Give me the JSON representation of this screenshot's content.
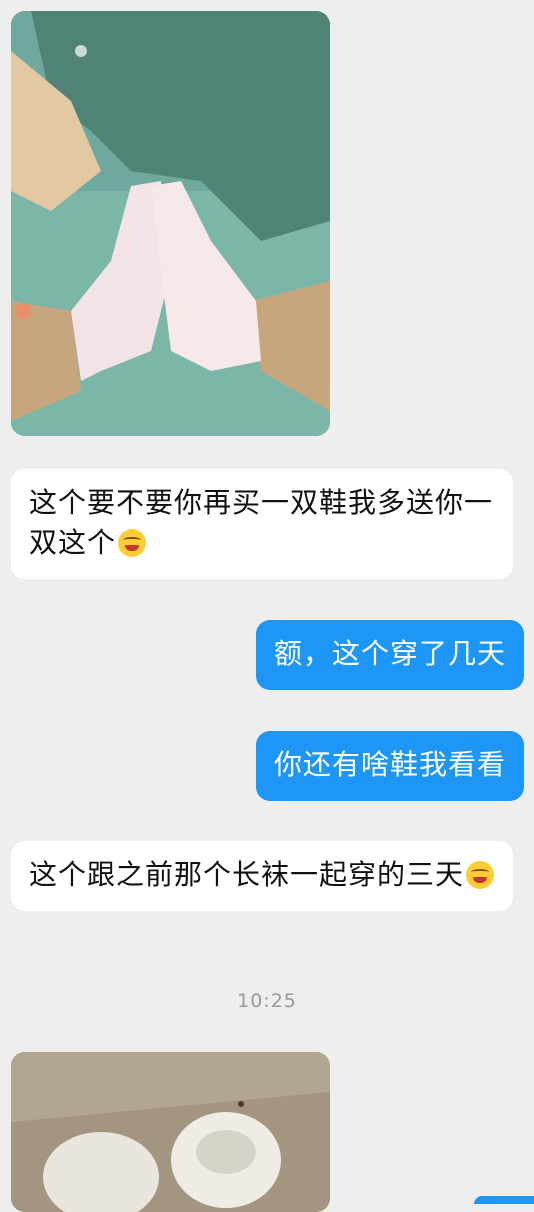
{
  "messages": [
    {
      "type": "image",
      "from": "them",
      "alt": "photo"
    },
    {
      "type": "text",
      "from": "them",
      "text": "这个要不要你再买一双鞋我多送你一双这个",
      "emoji": "laughing-crying-emoji"
    },
    {
      "type": "text",
      "from": "me",
      "text": "额，这个穿了几天"
    },
    {
      "type": "text",
      "from": "me",
      "text": "你还有啥鞋我看看"
    },
    {
      "type": "text",
      "from": "them",
      "text": "这个跟之前那个长袜一起穿的三天",
      "emoji": "laughing-crying-emoji"
    },
    {
      "type": "timestamp",
      "text": "10:25"
    },
    {
      "type": "image",
      "from": "them",
      "alt": "photo"
    }
  ],
  "colors": {
    "background": "#eeeeee",
    "incoming_bubble": "#ffffff",
    "outgoing_bubble": "#1e96f5",
    "timestamp_text": "#9a9a9a"
  }
}
